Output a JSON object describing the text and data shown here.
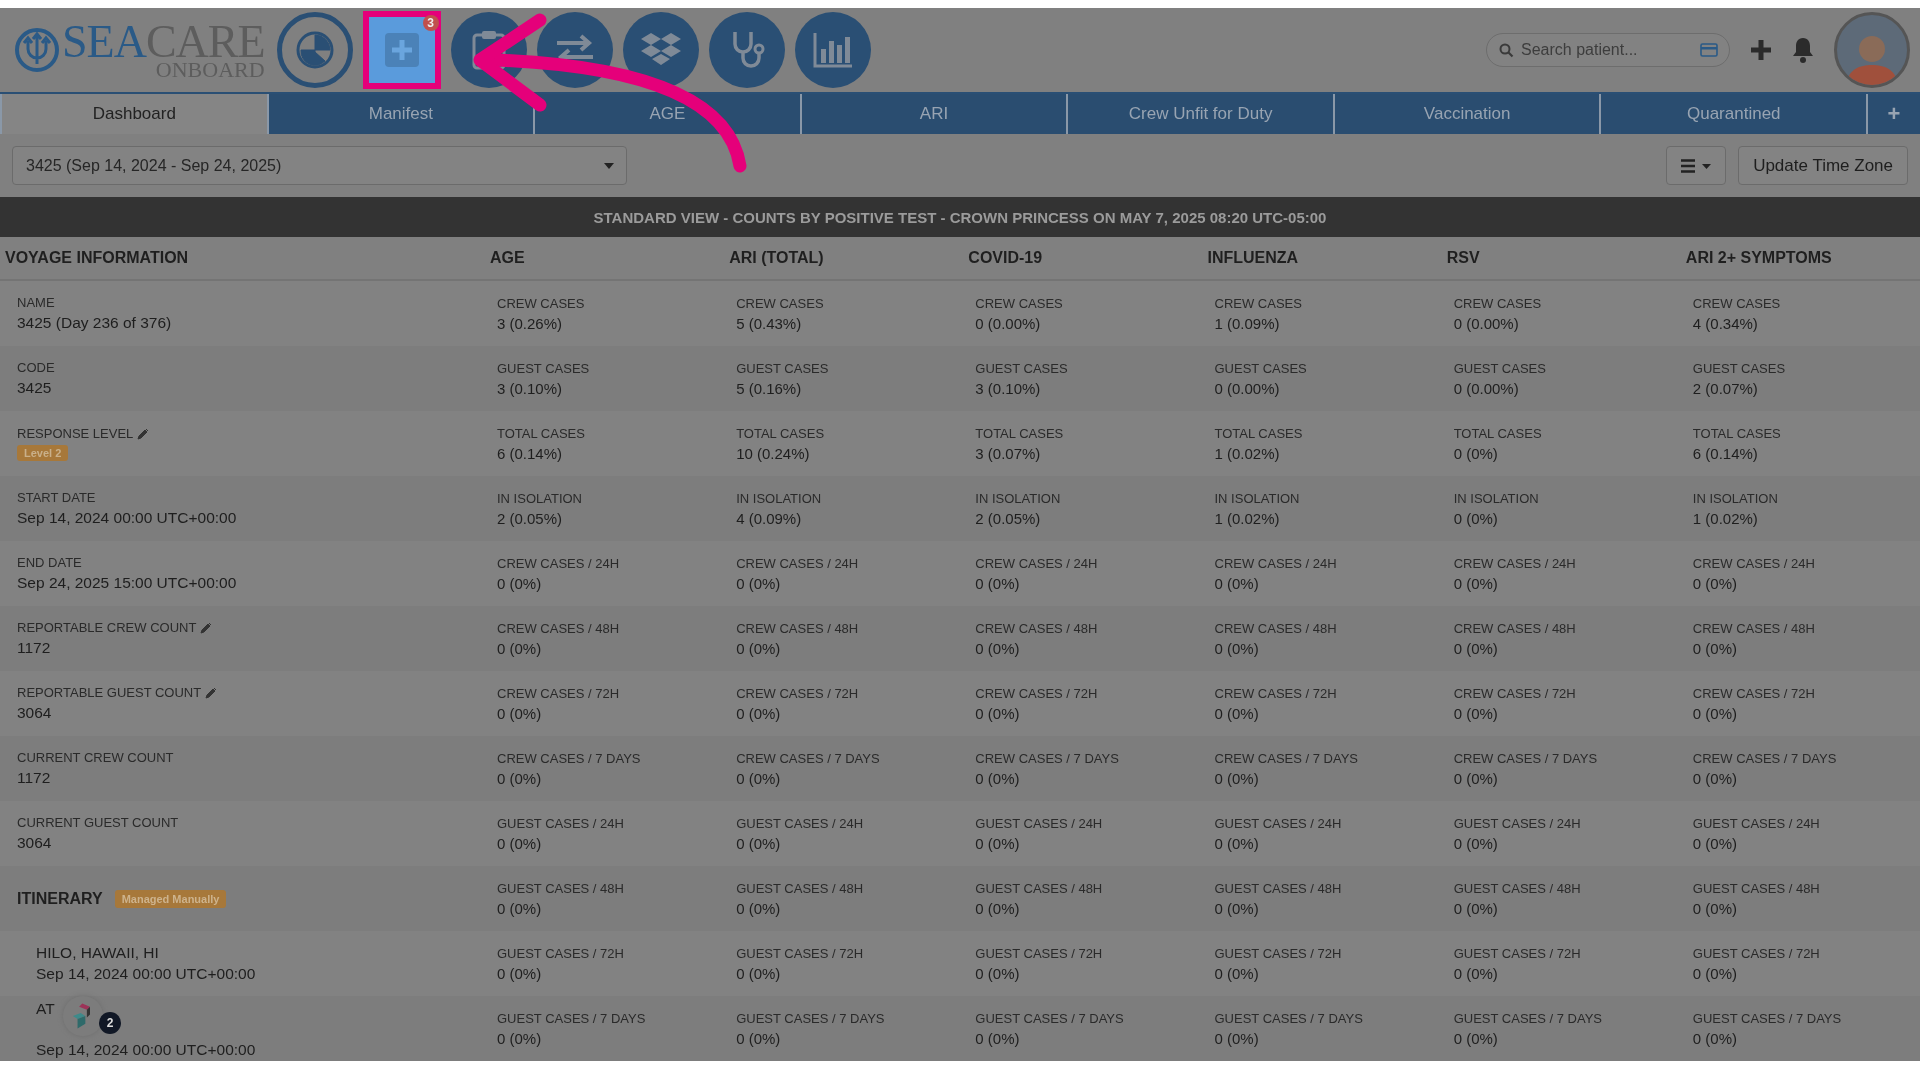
{
  "logo": {
    "primary": "SEA",
    "secondary": "CARE",
    "sub": "ONBOARD"
  },
  "nav_buttons": [
    {
      "highlighted": false
    },
    {
      "highlighted": true,
      "badge": "3"
    },
    {
      "highlighted": false
    },
    {
      "highlighted": false
    },
    {
      "highlighted": false
    },
    {
      "highlighted": false
    },
    {
      "highlighted": false
    }
  ],
  "search": {
    "placeholder": "Search patient..."
  },
  "tabs": [
    {
      "label": "Dashboard",
      "selected": true
    },
    {
      "label": "Manifest",
      "selected": false
    },
    {
      "label": "AGE",
      "selected": false
    },
    {
      "label": "ARI",
      "selected": false
    },
    {
      "label": "Crew Unfit for Duty",
      "selected": false
    },
    {
      "label": "Vaccination",
      "selected": false
    },
    {
      "label": "Quarantined",
      "selected": false
    },
    {
      "label": "+",
      "selected": false
    }
  ],
  "voyage_select": {
    "value": "3425 (Sep 14, 2024 - Sep 24, 2025)"
  },
  "update_button": "Update Time Zone",
  "banner": "STANDARD VIEW - COUNTS BY POSITIVE TEST - CROWN PRINCESS ON MAY 7, 2025 08:20 UTC-05:00",
  "voyage_info": {
    "heading": "VOYAGE INFORMATION",
    "fields": [
      {
        "label": "NAME",
        "value": "3425 (Day 236 of 376)",
        "editable": false
      },
      {
        "label": "CODE",
        "value": "3425",
        "editable": false
      },
      {
        "label": "RESPONSE LEVEL",
        "badge": "Level 2",
        "editable": true
      },
      {
        "label": "START DATE",
        "value": "Sep 14, 2024 00:00 UTC+00:00",
        "editable": false
      },
      {
        "label": "END DATE",
        "value": "Sep 24, 2025 15:00 UTC+00:00",
        "editable": false
      },
      {
        "label": "REPORTABLE CREW COUNT",
        "value": "1172",
        "editable": true
      },
      {
        "label": "REPORTABLE GUEST COUNT",
        "value": "3064",
        "editable": true
      },
      {
        "label": "CURRENT CREW COUNT",
        "value": "1172",
        "editable": false
      },
      {
        "label": "CURRENT GUEST COUNT",
        "value": "3064",
        "editable": false
      }
    ],
    "itinerary": {
      "heading": "ITINERARY",
      "badge": "Managed Manually",
      "stops": [
        {
          "name": "HILO, HAWAII, HI",
          "date": "Sep 14, 2024 00:00 UTC+00:00"
        },
        {
          "name": "AT",
          "date": "Sep 14, 2024 00:00 UTC+00:00"
        }
      ]
    }
  },
  "stat_columns": [
    {
      "heading": "AGE",
      "cells": [
        {
          "label": "CREW CASES",
          "value": "3 (0.26%)"
        },
        {
          "label": "GUEST CASES",
          "value": "3 (0.10%)"
        },
        {
          "label": "TOTAL CASES",
          "value": "6 (0.14%)"
        },
        {
          "label": "IN ISOLATION",
          "value": "2 (0.05%)"
        },
        {
          "label": "CREW CASES / 24H",
          "value": "0 (0%)"
        },
        {
          "label": "CREW CASES / 48H",
          "value": "0 (0%)"
        },
        {
          "label": "CREW CASES / 72H",
          "value": "0 (0%)"
        },
        {
          "label": "CREW CASES / 7 DAYS",
          "value": "0 (0%)"
        },
        {
          "label": "GUEST CASES / 24H",
          "value": "0 (0%)"
        },
        {
          "label": "GUEST CASES / 48H",
          "value": "0 (0%)"
        },
        {
          "label": "GUEST CASES / 72H",
          "value": "0 (0%)"
        },
        {
          "label": "GUEST CASES / 7 DAYS",
          "value": "0 (0%)"
        }
      ]
    },
    {
      "heading": "ARI (TOTAL)",
      "cells": [
        {
          "label": "CREW CASES",
          "value": "5 (0.43%)"
        },
        {
          "label": "GUEST CASES",
          "value": "5 (0.16%)"
        },
        {
          "label": "TOTAL CASES",
          "value": "10 (0.24%)"
        },
        {
          "label": "IN ISOLATION",
          "value": "4 (0.09%)"
        },
        {
          "label": "CREW CASES / 24H",
          "value": "0 (0%)"
        },
        {
          "label": "CREW CASES / 48H",
          "value": "0 (0%)"
        },
        {
          "label": "CREW CASES / 72H",
          "value": "0 (0%)"
        },
        {
          "label": "CREW CASES / 7 DAYS",
          "value": "0 (0%)"
        },
        {
          "label": "GUEST CASES / 24H",
          "value": "0 (0%)"
        },
        {
          "label": "GUEST CASES / 48H",
          "value": "0 (0%)"
        },
        {
          "label": "GUEST CASES / 72H",
          "value": "0 (0%)"
        },
        {
          "label": "GUEST CASES / 7 DAYS",
          "value": "0 (0%)"
        }
      ]
    },
    {
      "heading": "COVID-19",
      "cells": [
        {
          "label": "CREW CASES",
          "value": "0 (0.00%)"
        },
        {
          "label": "GUEST CASES",
          "value": "3 (0.10%)"
        },
        {
          "label": "TOTAL CASES",
          "value": "3 (0.07%)"
        },
        {
          "label": "IN ISOLATION",
          "value": "2 (0.05%)"
        },
        {
          "label": "CREW CASES / 24H",
          "value": "0 (0%)"
        },
        {
          "label": "CREW CASES / 48H",
          "value": "0 (0%)"
        },
        {
          "label": "CREW CASES / 72H",
          "value": "0 (0%)"
        },
        {
          "label": "CREW CASES / 7 DAYS",
          "value": "0 (0%)"
        },
        {
          "label": "GUEST CASES / 24H",
          "value": "0 (0%)"
        },
        {
          "label": "GUEST CASES / 48H",
          "value": "0 (0%)"
        },
        {
          "label": "GUEST CASES / 72H",
          "value": "0 (0%)"
        },
        {
          "label": "GUEST CASES / 7 DAYS",
          "value": "0 (0%)"
        }
      ]
    },
    {
      "heading": "INFLUENZA",
      "cells": [
        {
          "label": "CREW CASES",
          "value": "1 (0.09%)"
        },
        {
          "label": "GUEST CASES",
          "value": "0 (0.00%)"
        },
        {
          "label": "TOTAL CASES",
          "value": "1 (0.02%)"
        },
        {
          "label": "IN ISOLATION",
          "value": "1 (0.02%)"
        },
        {
          "label": "CREW CASES / 24H",
          "value": "0 (0%)"
        },
        {
          "label": "CREW CASES / 48H",
          "value": "0 (0%)"
        },
        {
          "label": "CREW CASES / 72H",
          "value": "0 (0%)"
        },
        {
          "label": "CREW CASES / 7 DAYS",
          "value": "0 (0%)"
        },
        {
          "label": "GUEST CASES / 24H",
          "value": "0 (0%)"
        },
        {
          "label": "GUEST CASES / 48H",
          "value": "0 (0%)"
        },
        {
          "label": "GUEST CASES / 72H",
          "value": "0 (0%)"
        },
        {
          "label": "GUEST CASES / 7 DAYS",
          "value": "0 (0%)"
        }
      ]
    },
    {
      "heading": "RSV",
      "cells": [
        {
          "label": "CREW CASES",
          "value": "0 (0.00%)"
        },
        {
          "label": "GUEST CASES",
          "value": "0 (0.00%)"
        },
        {
          "label": "TOTAL CASES",
          "value": "0 (0%)"
        },
        {
          "label": "IN ISOLATION",
          "value": "0 (0%)"
        },
        {
          "label": "CREW CASES / 24H",
          "value": "0 (0%)"
        },
        {
          "label": "CREW CASES / 48H",
          "value": "0 (0%)"
        },
        {
          "label": "CREW CASES / 72H",
          "value": "0 (0%)"
        },
        {
          "label": "CREW CASES / 7 DAYS",
          "value": "0 (0%)"
        },
        {
          "label": "GUEST CASES / 24H",
          "value": "0 (0%)"
        },
        {
          "label": "GUEST CASES / 48H",
          "value": "0 (0%)"
        },
        {
          "label": "GUEST CASES / 72H",
          "value": "0 (0%)"
        },
        {
          "label": "GUEST CASES / 7 DAYS",
          "value": "0 (0%)"
        }
      ]
    },
    {
      "heading": "ARI 2+ SYMPTOMS",
      "cells": [
        {
          "label": "CREW CASES",
          "value": "4 (0.34%)"
        },
        {
          "label": "GUEST CASES",
          "value": "2 (0.07%)"
        },
        {
          "label": "TOTAL CASES",
          "value": "6 (0.14%)"
        },
        {
          "label": "IN ISOLATION",
          "value": "1 (0.02%)"
        },
        {
          "label": "CREW CASES / 24H",
          "value": "0 (0%)"
        },
        {
          "label": "CREW CASES / 48H",
          "value": "0 (0%)"
        },
        {
          "label": "CREW CASES / 72H",
          "value": "0 (0%)"
        },
        {
          "label": "CREW CASES / 7 DAYS",
          "value": "0 (0%)"
        },
        {
          "label": "GUEST CASES / 24H",
          "value": "0 (0%)"
        },
        {
          "label": "GUEST CASES / 48H",
          "value": "0 (0%)"
        },
        {
          "label": "GUEST CASES / 72H",
          "value": "0 (0%)"
        },
        {
          "label": "GUEST CASES / 7 DAYS",
          "value": "0 (0%)"
        }
      ]
    }
  ],
  "help_widget": {
    "badge": "2"
  }
}
